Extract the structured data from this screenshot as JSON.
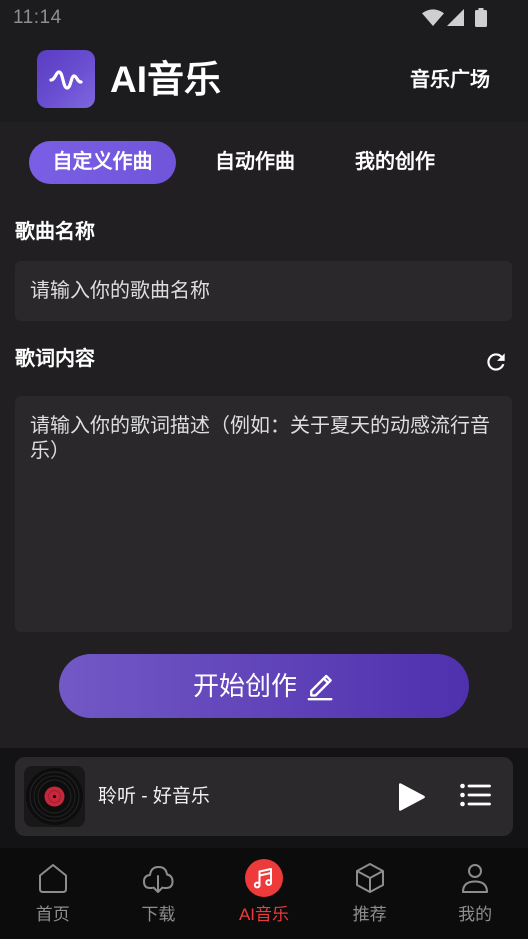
{
  "status_bar": {
    "time": "11:14",
    "icons": [
      "wifi-icon",
      "signal-icon",
      "battery-icon"
    ]
  },
  "header": {
    "logo_icon": "waveform-icon",
    "app_title": "AI音乐",
    "plaza_link": "音乐广场"
  },
  "tabs": [
    {
      "label": "自定义作曲",
      "active": true
    },
    {
      "label": "自动作曲",
      "active": false
    },
    {
      "label": "我的创作",
      "active": false
    }
  ],
  "form": {
    "song_name": {
      "label": "歌曲名称",
      "placeholder": "请输入你的歌曲名称"
    },
    "lyrics": {
      "label": "歌词内容",
      "placeholder": "请输入你的歌词描述（例如：关于夏天的动感流行音乐）",
      "refresh_icon": "refresh-icon"
    },
    "submit": {
      "label": "开始创作",
      "icon": "pencil-icon"
    }
  },
  "player": {
    "cover_icon": "vinyl-record-icon",
    "track_title": "聆听 - 好音乐",
    "play_icon": "play-icon",
    "playlist_icon": "playlist-icon"
  },
  "bottom_nav": [
    {
      "label": "首页",
      "icon": "home-icon",
      "active": false
    },
    {
      "label": "下载",
      "icon": "cloud-download-icon",
      "active": false
    },
    {
      "label": "AI音乐",
      "icon": "music-note-icon",
      "active": true
    },
    {
      "label": "推荐",
      "icon": "cube-icon",
      "active": false
    },
    {
      "label": "我的",
      "icon": "person-icon",
      "active": false
    }
  ],
  "colors": {
    "accent": "#7a5fe6",
    "active_nav": "#ee3a3a",
    "background": "#1c1b1e"
  }
}
